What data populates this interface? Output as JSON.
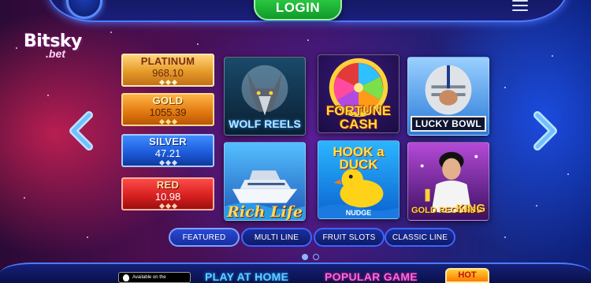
{
  "header": {
    "login_label": "LOGIN"
  },
  "logo": {
    "main": "Bitsky",
    "sub": ".bet"
  },
  "jackpots": [
    {
      "label": "PLATINUM",
      "value": "968.10"
    },
    {
      "label": "GOLD",
      "value": "1055.39"
    },
    {
      "label": "SILVER",
      "value": "47.21"
    },
    {
      "label": "RED",
      "value": "10.98"
    }
  ],
  "games": [
    {
      "title": "WOLF REELS"
    },
    {
      "title": "FORTUNE CASH"
    },
    {
      "title": "LUCKY BOWL"
    },
    {
      "title": "Rich Life"
    },
    {
      "title": "HOOK a DUCK",
      "subtitle": "NUDGE"
    },
    {
      "title": "GOLD RECORDS",
      "title2": "KING"
    }
  ],
  "tabs": [
    {
      "label": "FEATURED",
      "active": true
    },
    {
      "label": "MULTI LINE",
      "active": false
    },
    {
      "label": "FRUIT SLOTS",
      "active": false
    },
    {
      "label": "CLASSIC LINE",
      "active": false
    }
  ],
  "pager": {
    "current": 1,
    "total": 2
  },
  "footer": {
    "store_badge": "Available on the",
    "play_home": "PLAY AT HOME",
    "popular": "POPULAR GAME",
    "hot": "HOT"
  },
  "colors": {
    "login_green": "#1fb53a",
    "accent_blue": "#3c66ff",
    "platinum": "#e69a28",
    "gold": "#e0780e",
    "silver": "#1b58d8",
    "red": "#d41e1e"
  }
}
